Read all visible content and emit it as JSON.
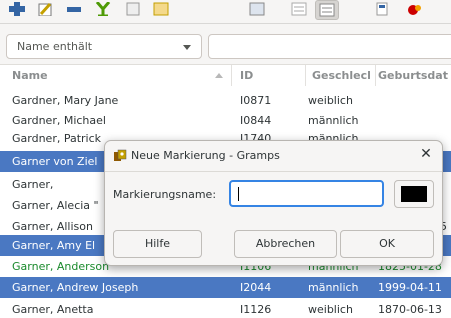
{
  "toolbar": {
    "icons": [
      "add-person-icon",
      "edit-icon",
      "remove-icon",
      "merge-icon",
      "filter-icon",
      "bookmark-icon",
      "view-grouped-icon",
      "view-flat-icon",
      "view-tree-icon",
      "note-icon",
      "sort-icon"
    ],
    "active_index": 8
  },
  "filter": {
    "combo_label": "Name enthält",
    "entry_value": ""
  },
  "table": {
    "headers": {
      "name": "Name",
      "id": "ID",
      "gender": "Geschlecl",
      "birth": "Geburtsdat"
    },
    "rows": [
      {
        "name": "Gardner, Mary Jane",
        "id": "I0871",
        "gender": "weiblich",
        "birth": ""
      },
      {
        "name": "Gardner, Michael",
        "id": "I0844",
        "gender": "männlich",
        "birth": ""
      },
      {
        "name": "Gardner, Patrick",
        "id": "I1740",
        "gender": "männlich",
        "birth": ""
      },
      {
        "name": "Garner von Ziel",
        "id": "",
        "gender": "",
        "birth": ""
      },
      {
        "name": "Garner,",
        "id": "",
        "gender": "",
        "birth": ""
      },
      {
        "name": "Garner, Alecia \"",
        "id": "",
        "gender": "",
        "birth": ""
      },
      {
        "name": "Garner, Allison",
        "id": "",
        "gender": "",
        "birth": "5"
      },
      {
        "name": "Garner, Amy El",
        "id": "",
        "gender": "",
        "birth": ""
      },
      {
        "name": "Garner, Anderson",
        "id": "I1106",
        "gender": "männlich",
        "birth": "1825-01-28"
      },
      {
        "name": "Garner, Andrew Joseph",
        "id": "I2044",
        "gender": "männlich",
        "birth": "1999-04-11"
      },
      {
        "name": "Garner, Anetta",
        "id": "I1126",
        "gender": "weiblich",
        "birth": "1870-06-13"
      }
    ]
  },
  "dialog": {
    "title": "Neue Markierung - Gramps",
    "close": "✕",
    "name_label": "Markierungsname:",
    "name_value": "",
    "color": "#000000",
    "help_button": "Hilfe",
    "cancel_button": "Abbrechen",
    "ok_button": "OK"
  },
  "colors": {
    "selection": "#4a78c2",
    "green_text": "#1a8a2c",
    "focus": "#3584e4"
  }
}
